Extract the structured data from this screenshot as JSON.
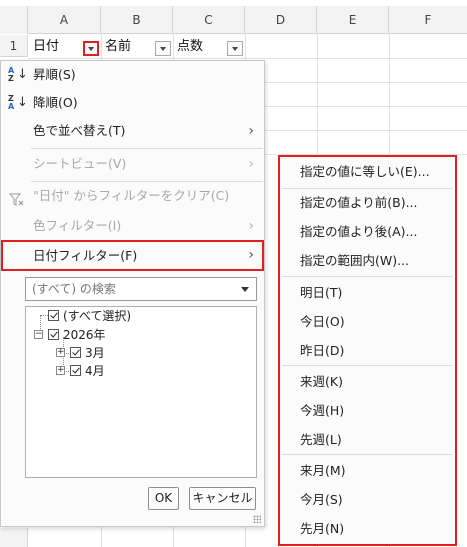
{
  "columns": [
    "A",
    "B",
    "C",
    "D",
    "E",
    "F"
  ],
  "row_numbers": [
    "1"
  ],
  "header_cells": [
    "日付",
    "名前",
    "点数"
  ],
  "colors": {
    "highlight": "#e02020",
    "disabled_text": "#a8a8a8"
  },
  "menu": {
    "sort_asc": "昇順(S)",
    "sort_desc": "降順(O)",
    "sort_by_color": "色で並べ替え(T)",
    "sheet_view": "シートビュー(V)",
    "clear_filter": "\"日付\" からフィルターをクリア(C)",
    "color_filter": "色フィルター(I)",
    "date_filter": "日付フィルター(F)",
    "search_placeholder": "(すべて) の検索",
    "tree": {
      "select_all": "(すべて選択)",
      "year": "2026年",
      "month1": "3月",
      "month2": "4月"
    },
    "ok": "OK",
    "cancel": "キャンセル"
  },
  "submenu": {
    "equals": "指定の値に等しい(E)...",
    "before": "指定の値より前(B)...",
    "after": "指定の値より後(A)...",
    "between": "指定の範囲内(W)...",
    "tomorrow": "明日(T)",
    "today": "今日(O)",
    "yesterday": "昨日(D)",
    "next_week": "来週(K)",
    "this_week": "今週(H)",
    "last_week": "先週(L)",
    "next_month": "来月(M)",
    "this_month": "今月(S)",
    "last_month": "先月(N)"
  },
  "icons": [
    "sort-ascending-icon",
    "sort-descending-icon",
    "clear-filter-icon",
    "chevron-right-icon",
    "dropdown-caret-icon",
    "checkbox-checked-icon",
    "tree-expander-icon",
    "resize-grip-icon"
  ]
}
